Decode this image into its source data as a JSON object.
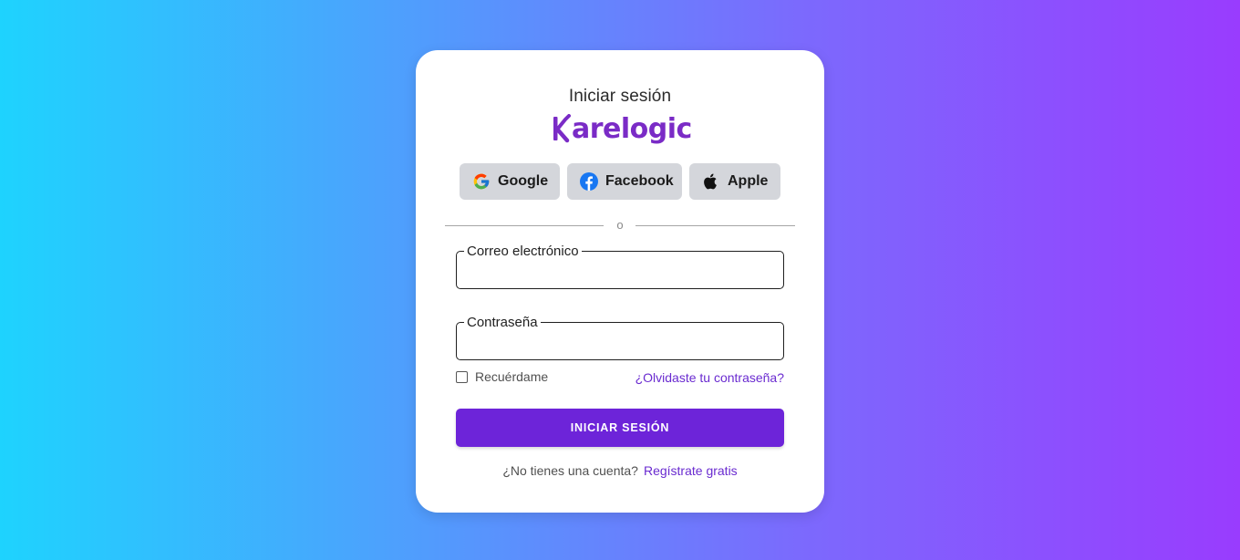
{
  "login": {
    "title": "Iniciar sesión",
    "brand": {
      "name": "Karelogic",
      "name_rest": "arelogic",
      "color": "#7a2bc6"
    },
    "social_buttons": [
      {
        "label": "Google",
        "icon": "google-icon"
      },
      {
        "label": "Facebook",
        "icon": "facebook-icon"
      },
      {
        "label": "Apple",
        "icon": "apple-icon"
      }
    ],
    "divider_text": "o",
    "fields": {
      "email": {
        "label": "Correo electrónico",
        "value": ""
      },
      "password": {
        "label": "Contraseña",
        "value": ""
      }
    },
    "remember_label": "Recuérdame",
    "remember_checked": false,
    "forgot_link": "¿Olvidaste tu contraseña?",
    "submit_label": "INICIAR SESIÓN",
    "signup_prompt": "¿No tienes una cuenta?",
    "signup_link": "Regístrate gratis"
  },
  "colors": {
    "primary": "#6d24d9",
    "link": "#6a2bd0",
    "social_bg": "#d4d6db",
    "gradient_start": "#1ed3fe",
    "gradient_end": "#993cfe"
  }
}
